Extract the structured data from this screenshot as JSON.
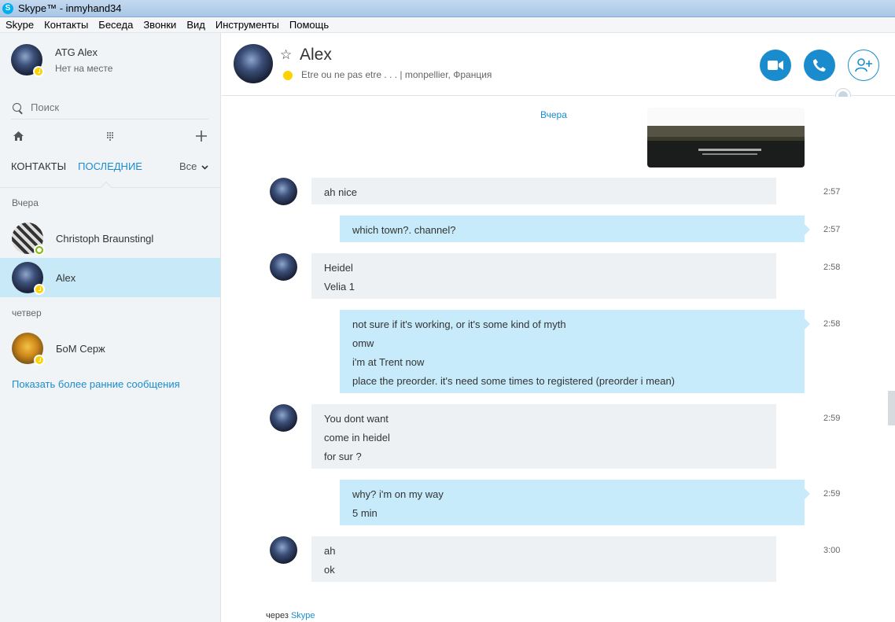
{
  "window": {
    "title": "Skype™ - inmyhand34",
    "logo_letter": "S"
  },
  "menu": [
    "Skype",
    "Контакты",
    "Беседа",
    "Звонки",
    "Вид",
    "Инструменты",
    "Помощь"
  ],
  "profile": {
    "name": "ATG Alex",
    "status": "Нет на месте"
  },
  "search": {
    "placeholder": "Поиск"
  },
  "tools": {
    "home_icon": "home-icon",
    "dialpad_icon": "dialpad-icon",
    "add_icon": "plus-icon"
  },
  "tabs": {
    "contacts": "КОНТАКТЫ",
    "recent": "ПОСЛЕДНИЕ",
    "filter": "Все"
  },
  "groups": [
    {
      "label": "Вчера",
      "contacts": [
        {
          "name": "Christoph Braunstingl",
          "status": "online"
        },
        {
          "name": "Alex",
          "status": "away",
          "selected": true
        }
      ]
    },
    {
      "label": "четвер",
      "contacts": [
        {
          "name": "БоМ Серж",
          "status": "away"
        }
      ]
    }
  ],
  "show_older": "Показать более ранние сообщения",
  "header": {
    "name": "Alex",
    "mood": "Etre ou ne pas etre . . .  |  monpellier, Франция",
    "buttons": [
      "video-call-icon",
      "audio-call-icon",
      "add-contact-icon"
    ]
  },
  "conversation": {
    "day": "Вчера",
    "messages": [
      {
        "dir": "in",
        "time": "2:57",
        "lines": [
          "ah nice"
        ]
      },
      {
        "dir": "out",
        "time": "2:57",
        "lines": [
          "which town?. channel?"
        ]
      },
      {
        "dir": "in",
        "time": "2:58",
        "lines": [
          "Heidel",
          "Velia 1"
        ]
      },
      {
        "dir": "out",
        "time": "2:58",
        "lines": [
          "not sure if it's working, or it's some kind of myth",
          "omw",
          "i'm at Trent now",
          "place the preorder. it's need some times to registered (preorder i mean)"
        ]
      },
      {
        "dir": "in",
        "time": "2:59",
        "lines": [
          "You dont want",
          "come in heidel",
          "for sur ?"
        ]
      },
      {
        "dir": "out",
        "time": "2:59",
        "lines": [
          "why? i'm on my way",
          "5 min"
        ]
      },
      {
        "dir": "in",
        "time": "3:00",
        "lines": [
          "ah",
          "ok"
        ]
      }
    ],
    "via_prefix": "через",
    "via_link": "Skype"
  },
  "colors": {
    "accent": "#1a8ccd",
    "away": "#fdd203",
    "online": "#7fba00",
    "outgoing_bubble": "#c7ebfb",
    "incoming_bubble": "#eef1f4"
  }
}
